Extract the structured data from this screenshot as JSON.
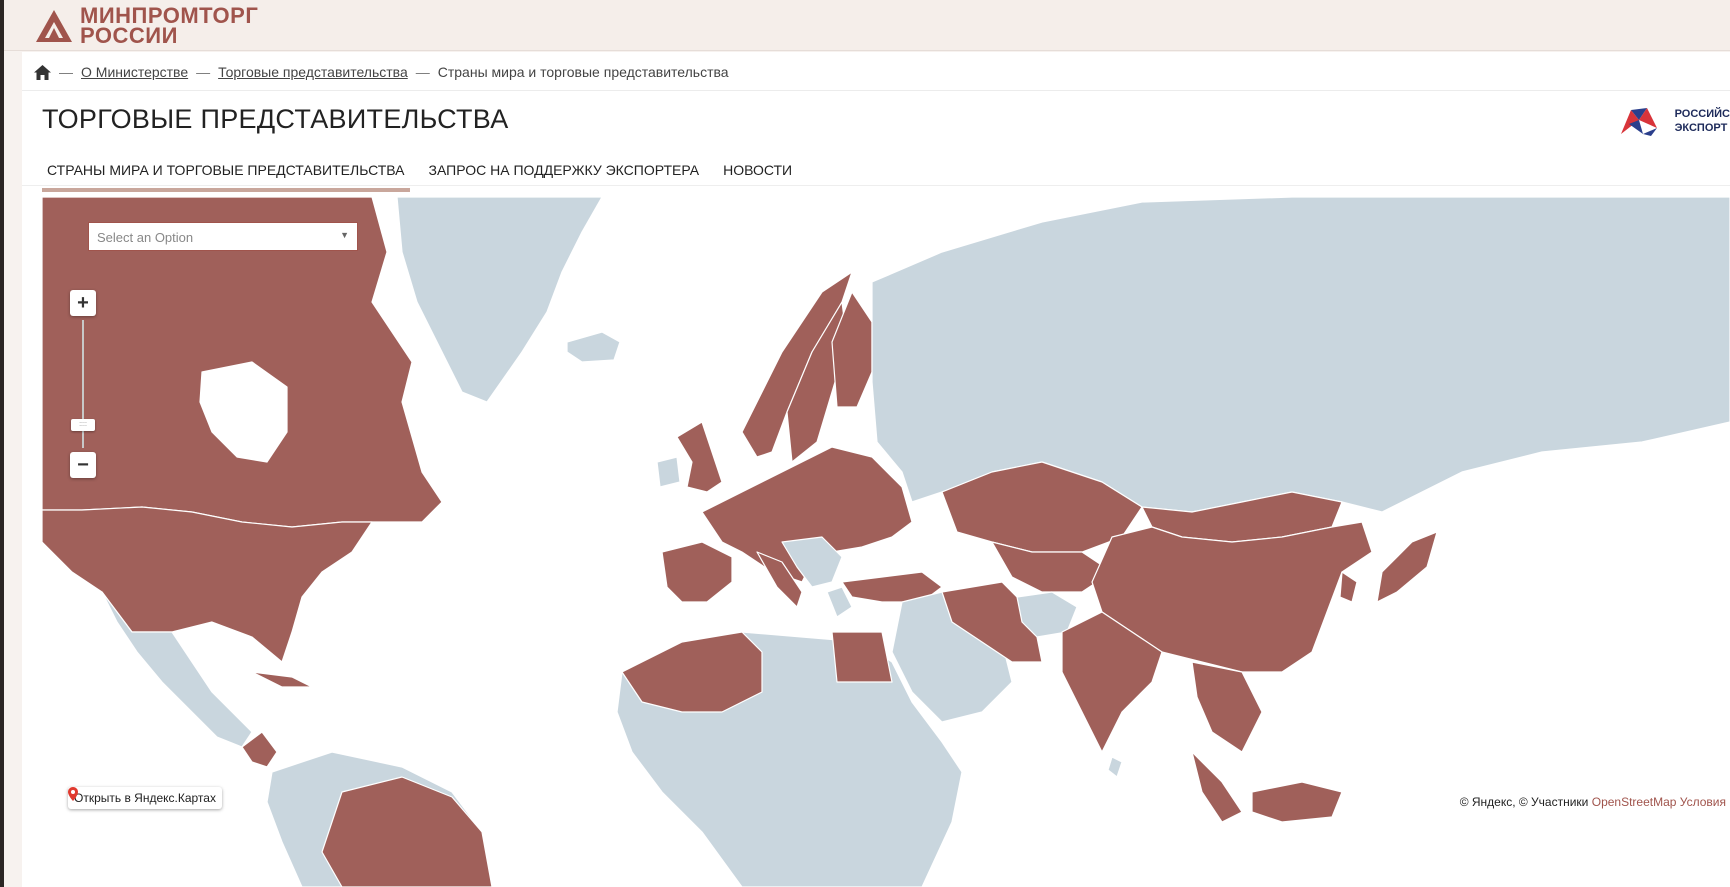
{
  "header": {
    "logo_line1": "МИНПРОМТОРГ",
    "logo_line2": "РОССИИ"
  },
  "breadcrumb": {
    "home_icon": "home-icon",
    "items": [
      "О Министерстве",
      "Торговые представительства",
      "Страны мира и торговые представительства"
    ],
    "separator": "—"
  },
  "page": {
    "title": "ТОРГОВЫЕ ПРЕДСТАВИТЕЛЬСТВА",
    "partner_line1": "РОССИЙС",
    "partner_line2": "ЭКСПОРТ"
  },
  "tabs": [
    {
      "label": "СТРАНЫ МИРА И ТОРГОВЫЕ ПРЕДСТАВИТЕЛЬСТВА",
      "active": true
    },
    {
      "label": "ЗАПРОС НА ПОДДЕРЖКУ ЭКСПОРТЕРА",
      "active": false
    },
    {
      "label": "НОВОСТИ",
      "active": false
    }
  ],
  "map": {
    "select_placeholder": "Select an Option",
    "zoom_in": "+",
    "zoom_out": "−",
    "zoom_handle": "::::",
    "open_maps_label": "Открыть в Яндекс.Картах",
    "copyright_text": "© Яндекс, © Участники ",
    "copyright_link": "OpenStreetMap",
    "copyright_terms": " Условия",
    "colors": {
      "highlight": "#a0605a",
      "land": "#c9d6de",
      "water": "#ffffff",
      "brand": "#a0544c"
    }
  }
}
